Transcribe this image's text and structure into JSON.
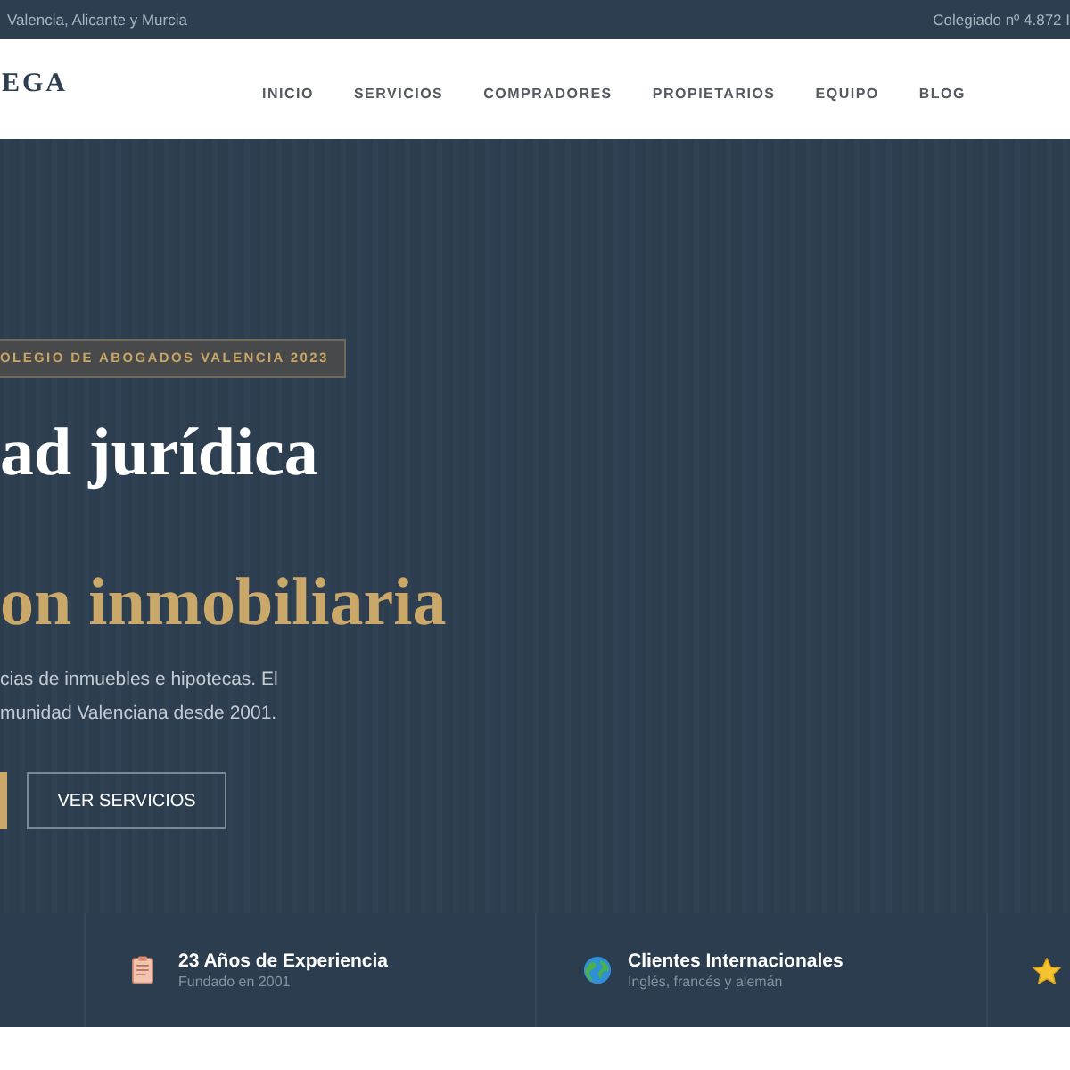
{
  "top_bar": {
    "location": "Valencia, Alicante y Murcia",
    "registration": "Colegiado nº 4.872 I"
  },
  "header": {
    "logo": "EGA",
    "nav": [
      {
        "label": "INICIO"
      },
      {
        "label": "SERVICIOS"
      },
      {
        "label": "COMPRADORES"
      },
      {
        "label": "PROPIETARIOS"
      },
      {
        "label": "EQUIPO"
      },
      {
        "label": "BLOG"
      }
    ]
  },
  "hero": {
    "badge": "OLEGIO DE ABOGADOS VALENCIA 2023",
    "heading_lines": [
      {
        "kind": "plain",
        "text": "ad jurídica"
      },
      {
        "kind": "accent",
        "text": "on inmobiliaria"
      }
    ],
    "description_lines": [
      "cias de inmuebles e hipotecas. El",
      "munidad Valenciana desde 2001."
    ],
    "buttons": [
      {
        "kind": "primary"
      },
      {
        "kind": "outline",
        "label": "VER SERVICIOS"
      }
    ]
  },
  "features": [
    {
      "kind": "full",
      "title": "23 Años de Experiencia",
      "subtitle": "Fundado en 2001"
    },
    {
      "kind": "full",
      "title": "Clientes Internacionales",
      "subtitle": "Inglés, francés y alemán"
    },
    {
      "kind": "icon_only"
    }
  ]
}
